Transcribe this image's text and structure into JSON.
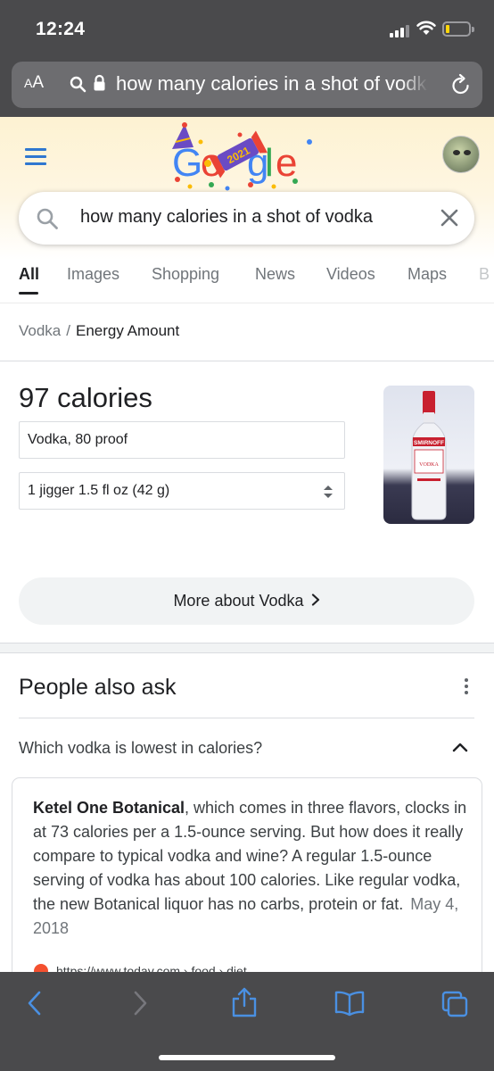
{
  "status_bar": {
    "time": "12:24"
  },
  "browser": {
    "text_size_label": "AA",
    "address_text": "how many calories in a shot of vodka"
  },
  "google": {
    "search_query": "how many calories in a shot of vodka",
    "doodle_badge": "2021",
    "tabs": [
      "All",
      "Images",
      "Shopping",
      "News",
      "Videos",
      "Maps",
      "B"
    ],
    "active_tab": "All"
  },
  "breadcrumb": {
    "parent": "Vodka",
    "separator": "/",
    "current": "Energy Amount"
  },
  "nutrition": {
    "calories": "97 calories",
    "food": "Vodka, 80 proof",
    "serving": "1 jigger 1.5 fl oz (42 g)",
    "more_button": "More about Vodka",
    "image_brand": "SMIRNOFF",
    "image_label": "VODKA"
  },
  "people_also_ask": {
    "title": "People also ask",
    "question": "Which vodka is lowest in calories?",
    "answer_bold": "Ketel One Botanical",
    "answer_text": ", which comes in three flavors, clocks in at 73 calories per a 1.5-ounce serving. But how does it really compare to typical vodka and wine? A regular 1.5-ounce serving of vodka has about 100 calories. Like regular vodka, the new Botanical liquor has no carbs, protein or fat.",
    "answer_date": "May 4, 2018",
    "source_url": "https://www.today.com › food › diet"
  },
  "colors": {
    "chrome_bg": "#4a4a4c",
    "ios_blue": "#2f77d0",
    "toolbar_blue": "#4a90e2",
    "battery": "#ffd60a"
  }
}
